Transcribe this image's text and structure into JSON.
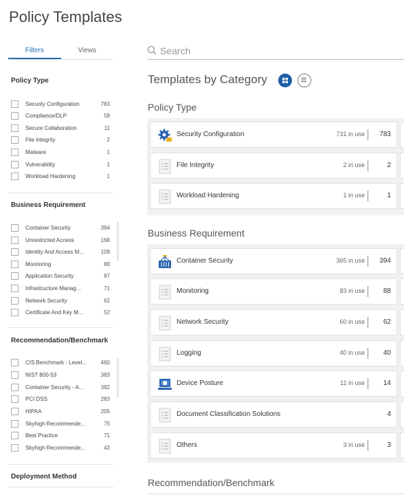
{
  "page": {
    "title": "Policy Templates"
  },
  "tabs": [
    {
      "label": "Filters",
      "active": true
    },
    {
      "label": "Views",
      "active": false
    }
  ],
  "filters": {
    "policy_type": {
      "title": "Policy Type",
      "items": [
        {
          "label": "Security Configuration",
          "count": "783"
        },
        {
          "label": "Compliance/DLP",
          "count": "58"
        },
        {
          "label": "Secure Collaboration",
          "count": "11"
        },
        {
          "label": "File Integrity",
          "count": "2"
        },
        {
          "label": "Malware",
          "count": "1"
        },
        {
          "label": "Vulnerability",
          "count": "1"
        },
        {
          "label": "Workload Hardening",
          "count": "1"
        }
      ]
    },
    "business_requirement": {
      "title": "Business Requirement",
      "items": [
        {
          "label": "Container Security",
          "count": "394"
        },
        {
          "label": "Unrestricted Access",
          "count": "168"
        },
        {
          "label": "Identity And Access M...",
          "count": "109"
        },
        {
          "label": "Monitoring",
          "count": "88"
        },
        {
          "label": "Application Security",
          "count": "87"
        },
        {
          "label": "Infrastructure Manag...",
          "count": "71"
        },
        {
          "label": "Network Security",
          "count": "62"
        },
        {
          "label": "Certificate And Key M...",
          "count": "52"
        }
      ]
    },
    "recommendation_benchmark": {
      "title": "Recommendation/Benchmark",
      "items": [
        {
          "label": "CIS Benchmark - Level...",
          "count": "460"
        },
        {
          "label": "NIST 800-53",
          "count": "383"
        },
        {
          "label": "Container Security - A...",
          "count": "382"
        },
        {
          "label": "PCI DSS",
          "count": "283"
        },
        {
          "label": "HIPAA",
          "count": "205"
        },
        {
          "label": "Skyhigh Recommende...",
          "count": "75"
        },
        {
          "label": "Best Practice",
          "count": "71"
        },
        {
          "label": "Skyhigh Recommende...",
          "count": "43"
        }
      ]
    },
    "deployment_method": {
      "title": "Deployment Method"
    }
  },
  "search": {
    "placeholder": "Search"
  },
  "main": {
    "heading": "Templates by Category",
    "categories": [
      {
        "title": "Policy Type",
        "cards": [
          {
            "name": "Security Configuration",
            "in_use": "731 in use",
            "total": "783",
            "icon": "gear-lock-icon"
          },
          {
            "name": "File Integrity",
            "in_use": "2 in use",
            "total": "2",
            "icon": "document-list-icon"
          },
          {
            "name": "Workload Hardening",
            "in_use": "1 in use",
            "total": "1",
            "icon": "document-list-icon"
          }
        ]
      },
      {
        "title": "Business Requirement",
        "cards": [
          {
            "name": "Container Security",
            "in_use": "365 in use",
            "total": "394",
            "icon": "container-icon"
          },
          {
            "name": "Monitoring",
            "in_use": "83 in use",
            "total": "88",
            "icon": "document-list-icon"
          },
          {
            "name": "Network Security",
            "in_use": "60 in use",
            "total": "62",
            "icon": "document-list-icon"
          },
          {
            "name": "Logging",
            "in_use": "40 in use",
            "total": "40",
            "icon": "document-list-icon"
          },
          {
            "name": "Device Posture",
            "in_use": "11 in use",
            "total": "14",
            "icon": "laptop-shield-icon"
          },
          {
            "name": "Document Classification Solutions",
            "in_use": "",
            "total": "4",
            "icon": "document-list-icon"
          },
          {
            "name": "Others",
            "in_use": "3 in use",
            "total": "3",
            "icon": "document-list-icon"
          }
        ]
      },
      {
        "title": "Recommendation/Benchmark",
        "cards": []
      }
    ]
  },
  "colors": {
    "accent": "#1f5ea8",
    "tab_active": "#1f6fb2",
    "panel_bg": "#f1f1f1"
  }
}
